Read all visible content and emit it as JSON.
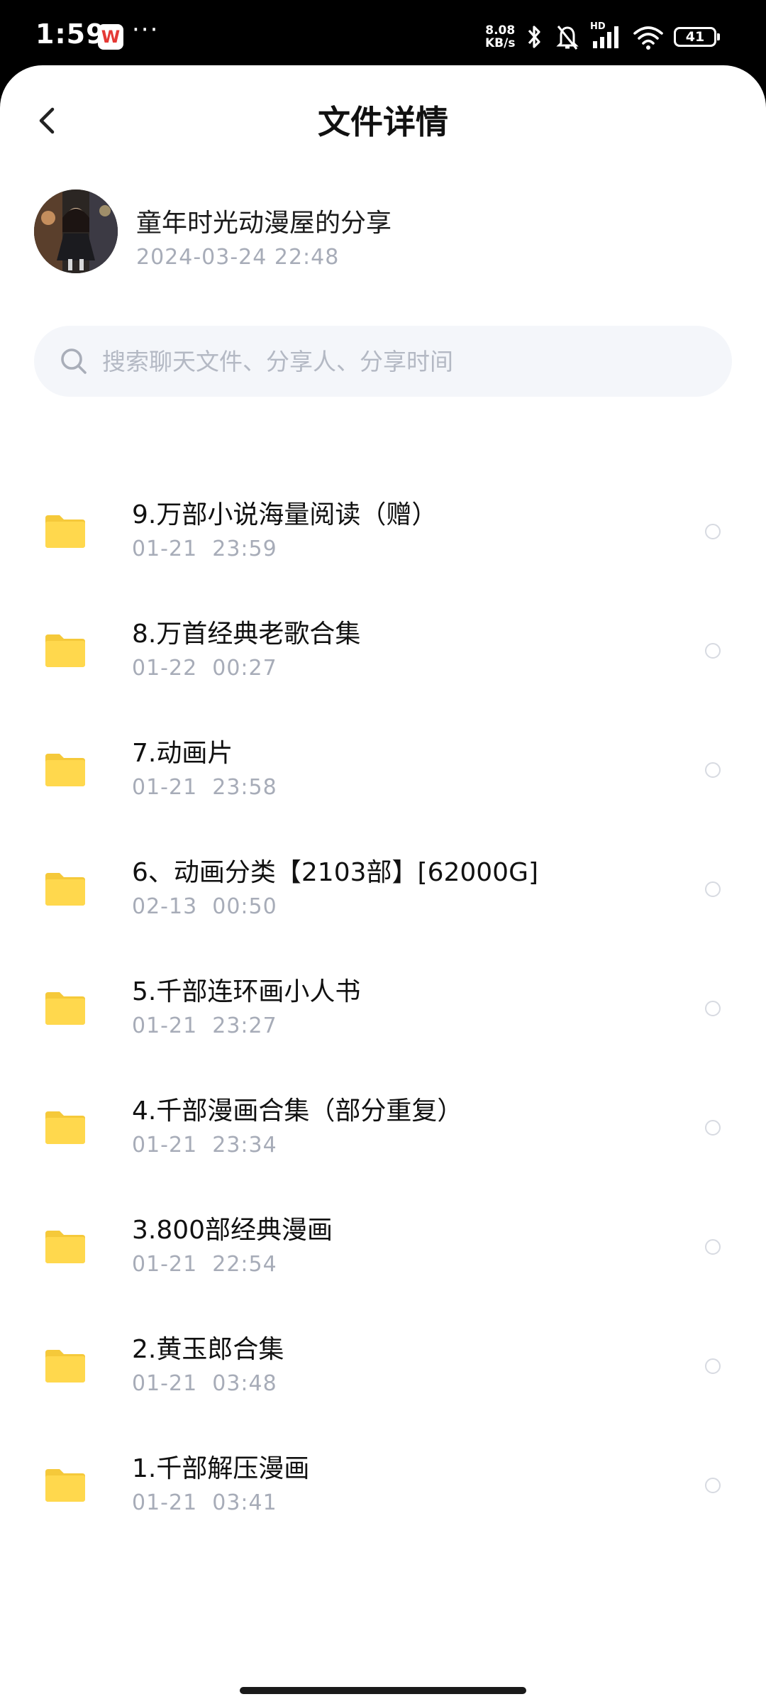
{
  "status_bar": {
    "time": "1:59",
    "app_badge": "W",
    "dots": "···",
    "net_speed_value": "8.08",
    "net_speed_unit": "KB/s",
    "hd_label": "HD",
    "battery": "41",
    "icons": [
      "bluetooth-icon",
      "bell-off-icon",
      "signal-icon",
      "wifi-icon",
      "battery-icon"
    ]
  },
  "header": {
    "title": "文件详情"
  },
  "sharer": {
    "name": "童年时光动漫屋的分享",
    "time": "2024-03-24  22:48"
  },
  "search": {
    "placeholder": "搜索聊天文件、分享人、分享时间",
    "value": ""
  },
  "colors": {
    "folder": "#ffd84d",
    "folder_tab": "#f5c93a",
    "muted_text": "#a7acb8",
    "search_bg": "#f4f6fa"
  },
  "files": [
    {
      "name": "9.万部小说海量阅读（赠）",
      "date": "01-21  23:59"
    },
    {
      "name": "8.万首经典老歌合集",
      "date": "01-22  00:27"
    },
    {
      "name": "7.动画片",
      "date": "01-21  23:58"
    },
    {
      "name": "6、动画分类【2103部】[62000G]",
      "date": "02-13  00:50"
    },
    {
      "name": "5.千部连环画小人书",
      "date": "01-21  23:27"
    },
    {
      "name": "4.千部漫画合集（部分重复）",
      "date": "01-21  23:34"
    },
    {
      "name": "3.800部经典漫画",
      "date": "01-21  22:54"
    },
    {
      "name": "2.黄玉郎合集",
      "date": "01-21  03:48"
    },
    {
      "name": "1.千部解压漫画",
      "date": "01-21  03:41"
    }
  ]
}
